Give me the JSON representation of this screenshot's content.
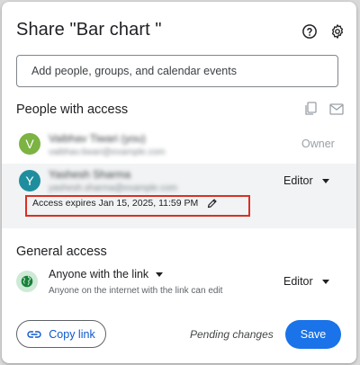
{
  "dialog": {
    "title": "Share \"Bar chart \"",
    "help_icon": "help-circle-icon",
    "settings_icon": "gear-icon"
  },
  "add_people": {
    "placeholder": "Add people, groups, and calendar events"
  },
  "people_section": {
    "title": "People with access",
    "copy_icon": "copy-emails-icon",
    "mail_icon": "mail-icon",
    "people": [
      {
        "initial": "V",
        "avatar_color": "#7cb342",
        "name": "Vaibhav Tiwari (you)",
        "email": "vaibhav.tiwari@example.com",
        "role": "Owner"
      },
      {
        "initial": "Y",
        "avatar_color": "#1e8e9e",
        "name": "Yashesh Sharma",
        "email": "yashesh.sharma@example.com",
        "role": "Editor"
      }
    ],
    "expiry_text": "Access expires Jan 15, 2025, 11:59 PM"
  },
  "general_access": {
    "title": "General access",
    "link_setting": "Anyone with the link",
    "description": "Anyone on the internet with the link can edit",
    "role": "Editor",
    "globe_color": "#188038"
  },
  "footer": {
    "copy_link": "Copy link",
    "pending": "Pending changes",
    "save": "Save"
  },
  "colors": {
    "primary_blue": "#1a73e8",
    "link_blue": "#0b57d0",
    "highlight_red": "#d93025"
  }
}
